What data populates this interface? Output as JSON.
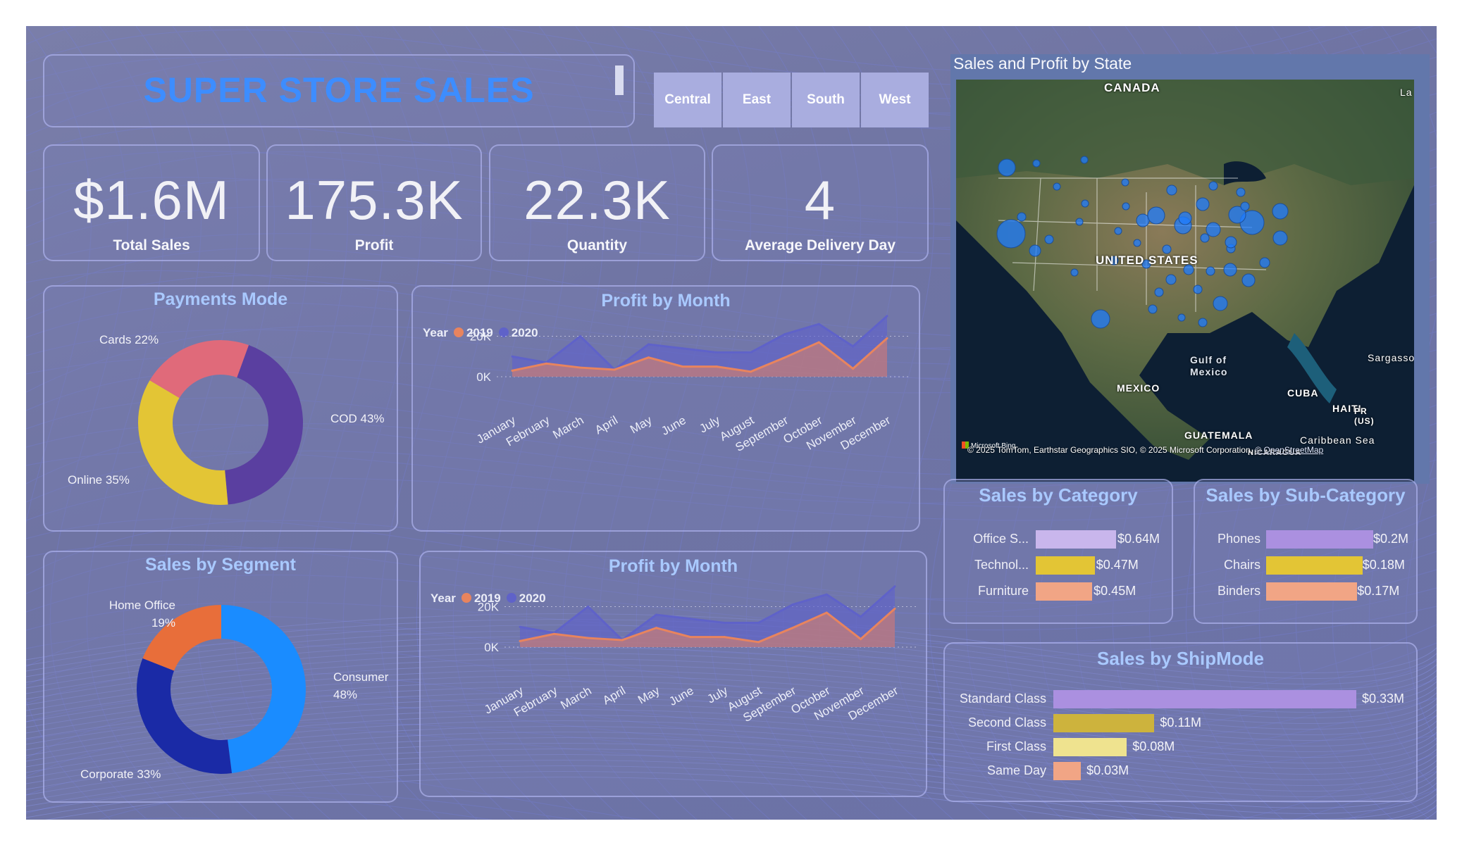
{
  "title": "SUPER STORE SALES",
  "regions": [
    "Central",
    "East",
    "South",
    "West"
  ],
  "kpis": [
    {
      "value": "$1.6M",
      "label": "Total Sales"
    },
    {
      "value": "175.3K",
      "label": "Profit"
    },
    {
      "value": "22.3K",
      "label": "Quantity"
    },
    {
      "value": "4",
      "label": "Average Delivery Day"
    }
  ],
  "map": {
    "title": "Sales and Profit by State",
    "labels": [
      "CANADA",
      "UNITED STATES",
      "MEXICO",
      "Gulf of Mexico",
      "CUBA",
      "HAITI",
      "PR (US)",
      "GUATEMALA",
      "Caribbean Sea",
      "Sargasso",
      "La",
      "NICARAGUA"
    ],
    "attribution": "© 2025 TomTom, Earthstar Geographics SIO, © 2025 Microsoft Corporation,",
    "attribution_link": "© OpenStreetMap",
    "logo_text": "Microsoft Bing"
  },
  "colors": {
    "y2019": "#e8845e",
    "y2020": "#5f62c9",
    "cod": "#5a3fa0",
    "online": "#e3c535",
    "cards": "#e06a7a",
    "consumer": "#1a8cff",
    "corporate": "#1a2aa6",
    "home_office": "#e86e3a",
    "title_blue": "#3d8dff"
  },
  "chart_data": [
    {
      "type": "pie",
      "title": "Payments Mode",
      "labels": [
        "COD",
        "Online",
        "Cards"
      ],
      "values": [
        43,
        35,
        22
      ],
      "display": [
        "COD 43%",
        "Online 35%",
        "Cards 22%"
      ]
    },
    {
      "type": "area",
      "title": "Profit by Month",
      "legend_title": "Year",
      "categories": [
        "January",
        "February",
        "March",
        "April",
        "May",
        "June",
        "July",
        "August",
        "September",
        "October",
        "November",
        "December"
      ],
      "series": [
        {
          "name": "2019",
          "values": [
            3000,
            6500,
            4500,
            3500,
            9500,
            5000,
            5000,
            2500,
            9500,
            17000,
            4000,
            19000
          ]
        },
        {
          "name": "2020",
          "values": [
            10000,
            7000,
            20000,
            3500,
            16000,
            14000,
            12000,
            12000,
            21000,
            26000,
            15000,
            30000
          ]
        }
      ],
      "yticks": [
        "0K",
        "20K"
      ],
      "ylim": [
        0,
        32000
      ]
    },
    {
      "type": "pie",
      "title": "Sales by Segment",
      "labels": [
        "Consumer",
        "Corporate",
        "Home Office"
      ],
      "values": [
        48,
        33,
        19
      ],
      "display": [
        "Consumer 48%",
        "Corporate 33%",
        "Home Office 19%"
      ]
    },
    {
      "type": "area",
      "title": "Profit by Month",
      "legend_title": "Year",
      "categories": [
        "January",
        "February",
        "March",
        "April",
        "May",
        "June",
        "July",
        "August",
        "September",
        "October",
        "November",
        "December"
      ],
      "series": [
        {
          "name": "2019",
          "values": [
            3000,
            6500,
            4500,
            3500,
            9500,
            5000,
            5000,
            2500,
            9500,
            17000,
            4000,
            19000
          ]
        },
        {
          "name": "2020",
          "values": [
            10000,
            7000,
            20000,
            3500,
            16000,
            14000,
            12000,
            12000,
            21000,
            26000,
            15000,
            30000
          ]
        }
      ],
      "yticks": [
        "0K",
        "20K"
      ],
      "ylim": [
        0,
        32000
      ]
    },
    {
      "type": "bar",
      "title": "Sales by Category",
      "categories": [
        "Office S...",
        "Technol...",
        "Furniture"
      ],
      "values": [
        0.64,
        0.47,
        0.45
      ],
      "display": [
        "$0.64M",
        "$0.47M",
        "$0.45M"
      ],
      "colors": [
        "#c9b6ec",
        "#e3c535",
        "#f1a585"
      ]
    },
    {
      "type": "bar",
      "title": "Sales by Sub-Category",
      "categories": [
        "Phones",
        "Chairs",
        "Binders"
      ],
      "values": [
        0.2,
        0.18,
        0.17
      ],
      "display": [
        "$0.2M",
        "$0.18M",
        "$0.17M"
      ],
      "colors": [
        "#ab90e0",
        "#e3c535",
        "#f1a585"
      ]
    },
    {
      "type": "bar",
      "title": "Sales by ShipMode",
      "categories": [
        "Standard Class",
        "Second Class",
        "First Class",
        "Same Day"
      ],
      "values": [
        0.33,
        0.11,
        0.08,
        0.03
      ],
      "display": [
        "$0.33M",
        "$0.11M",
        "$0.08M",
        "$0.03M"
      ],
      "colors": [
        "#ab90e0",
        "#cdb33d",
        "#efe38f",
        "#f1a585"
      ]
    }
  ]
}
